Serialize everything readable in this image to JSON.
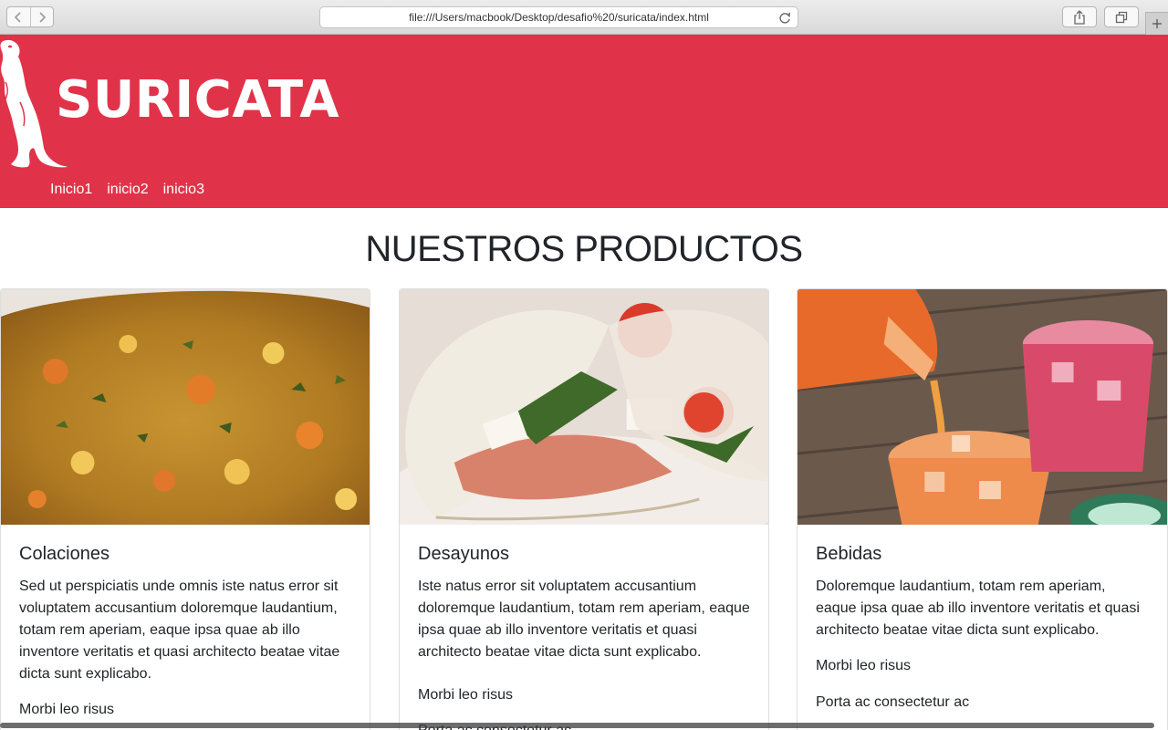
{
  "browser": {
    "url": "file:///Users/macbook/Desktop/desafio%20/suricata/index.html",
    "back_icon": "chevron-left-icon",
    "forward_icon": "chevron-right-icon",
    "reload_icon": "reload-icon",
    "share_icon": "share-icon",
    "tabs_icon": "tabs-icon",
    "new_tab_icon": "plus-icon"
  },
  "header": {
    "brand": "SURICATA",
    "logo_icon": "meerkat-icon",
    "background_color": "#e03349",
    "nav": [
      {
        "label": "Inicio1"
      },
      {
        "label": "inicio2"
      },
      {
        "label": "inicio3"
      }
    ]
  },
  "main": {
    "title": "NUESTROS PRODUCTOS",
    "cards": [
      {
        "image": "food-photo",
        "title": "Colaciones",
        "text": "Sed ut perspiciatis unde omnis iste natus error sit voluptatem accusantium doloremque laudantium, totam rem aperiam, eaque ipsa quae ab illo inventore veritatis et quasi architecto beatae vitae dicta sunt explicabo.",
        "items": [
          "Morbi leo risus"
        ]
      },
      {
        "image": "sandwich-photo",
        "title": "Desayunos",
        "text": "Iste natus error sit voluptatem accusantium doloremque laudantium, totam rem aperiam, eaque ipsa quae ab illo inventore veritatis et quasi architecto beatae vitae dicta sunt explicabo.",
        "items": [
          "Morbi leo risus",
          "Porta ac consectetur ac"
        ]
      },
      {
        "image": "drinks-photo",
        "title": "Bebidas",
        "text": "Doloremque laudantium, totam rem aperiam, eaque ipsa quae ab illo inventore veritatis et quasi architecto beatae vitae dicta sunt explicabo.",
        "items": [
          "Morbi leo risus",
          "Porta ac consectetur ac"
        ]
      }
    ]
  }
}
